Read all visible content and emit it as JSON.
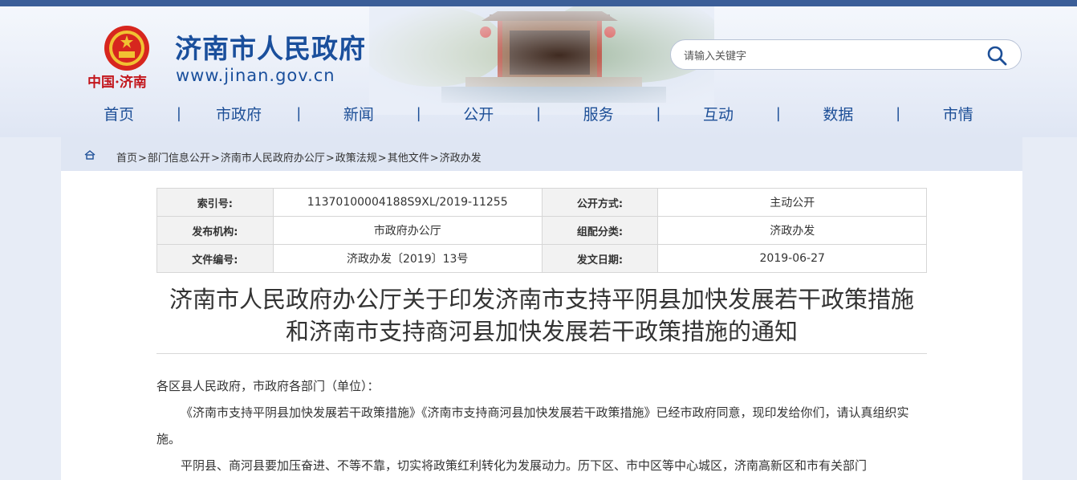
{
  "header": {
    "logo_text": "中国·济南",
    "site_title": "济南市人民政府",
    "site_url": "www.jinan.gov.cn"
  },
  "search": {
    "placeholder": "请输入关键字",
    "icon": "search-icon"
  },
  "nav": {
    "items": [
      "首页",
      "市政府",
      "新闻",
      "公开",
      "服务",
      "互动",
      "数据",
      "市情"
    ],
    "separator": "|"
  },
  "breadcrumb": {
    "home_icon": "home-icon",
    "items": [
      "首页",
      "部门信息公开",
      "济南市人民政府办公厅",
      "政策法规",
      "其他文件",
      "济政办发"
    ],
    "separator": ">"
  },
  "meta": {
    "index_label": "索引号:",
    "index_value": "11370100004188S9XL/2019-11255",
    "open_label": "公开方式:",
    "open_value": "主动公开",
    "issuer_label": "发布机构:",
    "issuer_value": "市政府办公厅",
    "category_label": "组配分类:",
    "category_value": "济政办发",
    "docno_label": "文件编号:",
    "docno_value": "济政办发〔2019〕13号",
    "date_label": "发文日期:",
    "date_value": "2019-06-27"
  },
  "document": {
    "title_line1": "济南市人民政府办公厅关于印发济南市支持平阴县加快发展若干政策措施",
    "title_line2": "和济南市支持商河县加快发展若干政策措施的通知",
    "salutation": "各区县人民政府，市政府各部门（单位）：",
    "para1": "《济南市支持平阴县加快发展若干政策措施》《济南市支持商河县加快发展若干政策措施》已经市政府同意，现印发给你们，请认真组织实施。",
    "para2": "平阴县、商河县要加压奋进、不等不靠，切实将政策红利转化为发展动力。历下区、市中区等中心城区，济南高新区和市有关部门"
  },
  "colors": {
    "brand_blue": "#1a4f9c",
    "top_bar": "#3b5e98",
    "logo_red": "#c3161c"
  }
}
